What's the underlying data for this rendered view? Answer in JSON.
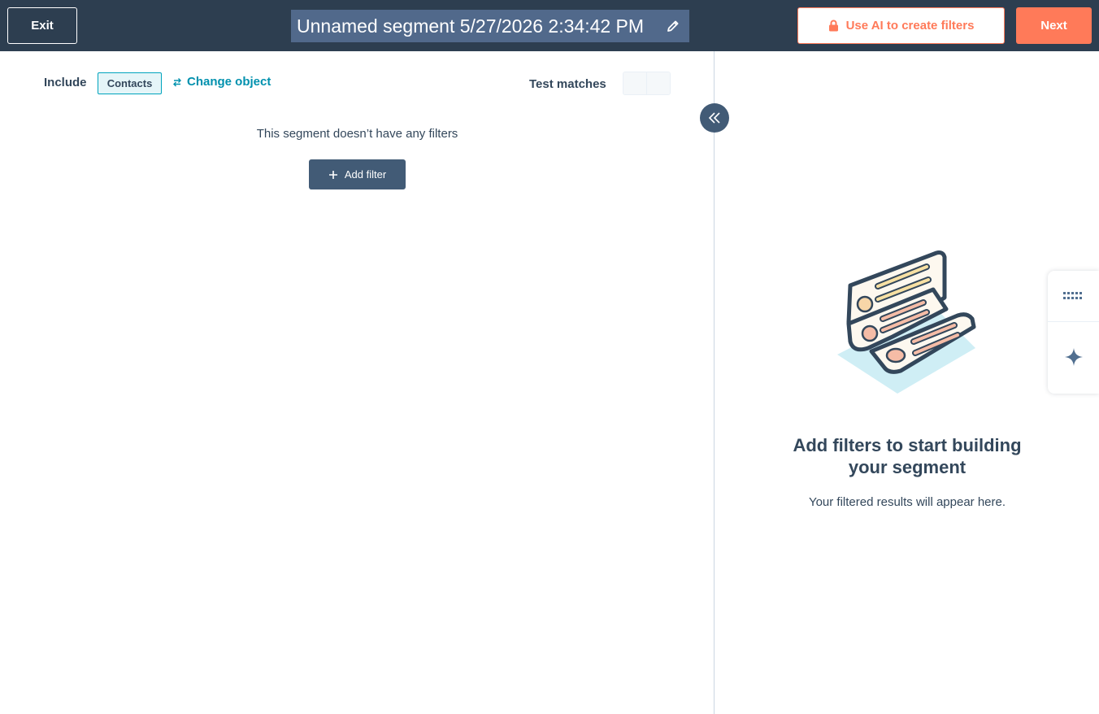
{
  "header": {
    "exit_label": "Exit",
    "title": "Unnamed segment 5/27/2026 2:34:42 PM",
    "ai_button_label": "Use AI to create filters",
    "next_label": "Next"
  },
  "filters_panel": {
    "include_label": "Include",
    "object_tag": "Contacts",
    "change_object_label": "Change object",
    "test_matches_label": "Test matches",
    "empty_message": "This segment doesn’t have any filters",
    "add_filter_label": "Add filter"
  },
  "results_panel": {
    "heading_line1": "Add filters to start building",
    "heading_line2": "your segment",
    "subtext": "Your filtered results will appear here."
  },
  "icons": {
    "edit": "pencil-icon",
    "lock": "lock-icon",
    "change_object": "swap-arrows-icon",
    "add": "plus-icon",
    "collapse": "double-chevron-left-icon",
    "dock_top": "keypad-icon",
    "dock_bottom": "sparkle-icon"
  },
  "colors": {
    "header_bg": "#2d3e50",
    "accent_orange": "#ff7a59",
    "link_teal": "#0091ae",
    "button_slate": "#425b76"
  }
}
